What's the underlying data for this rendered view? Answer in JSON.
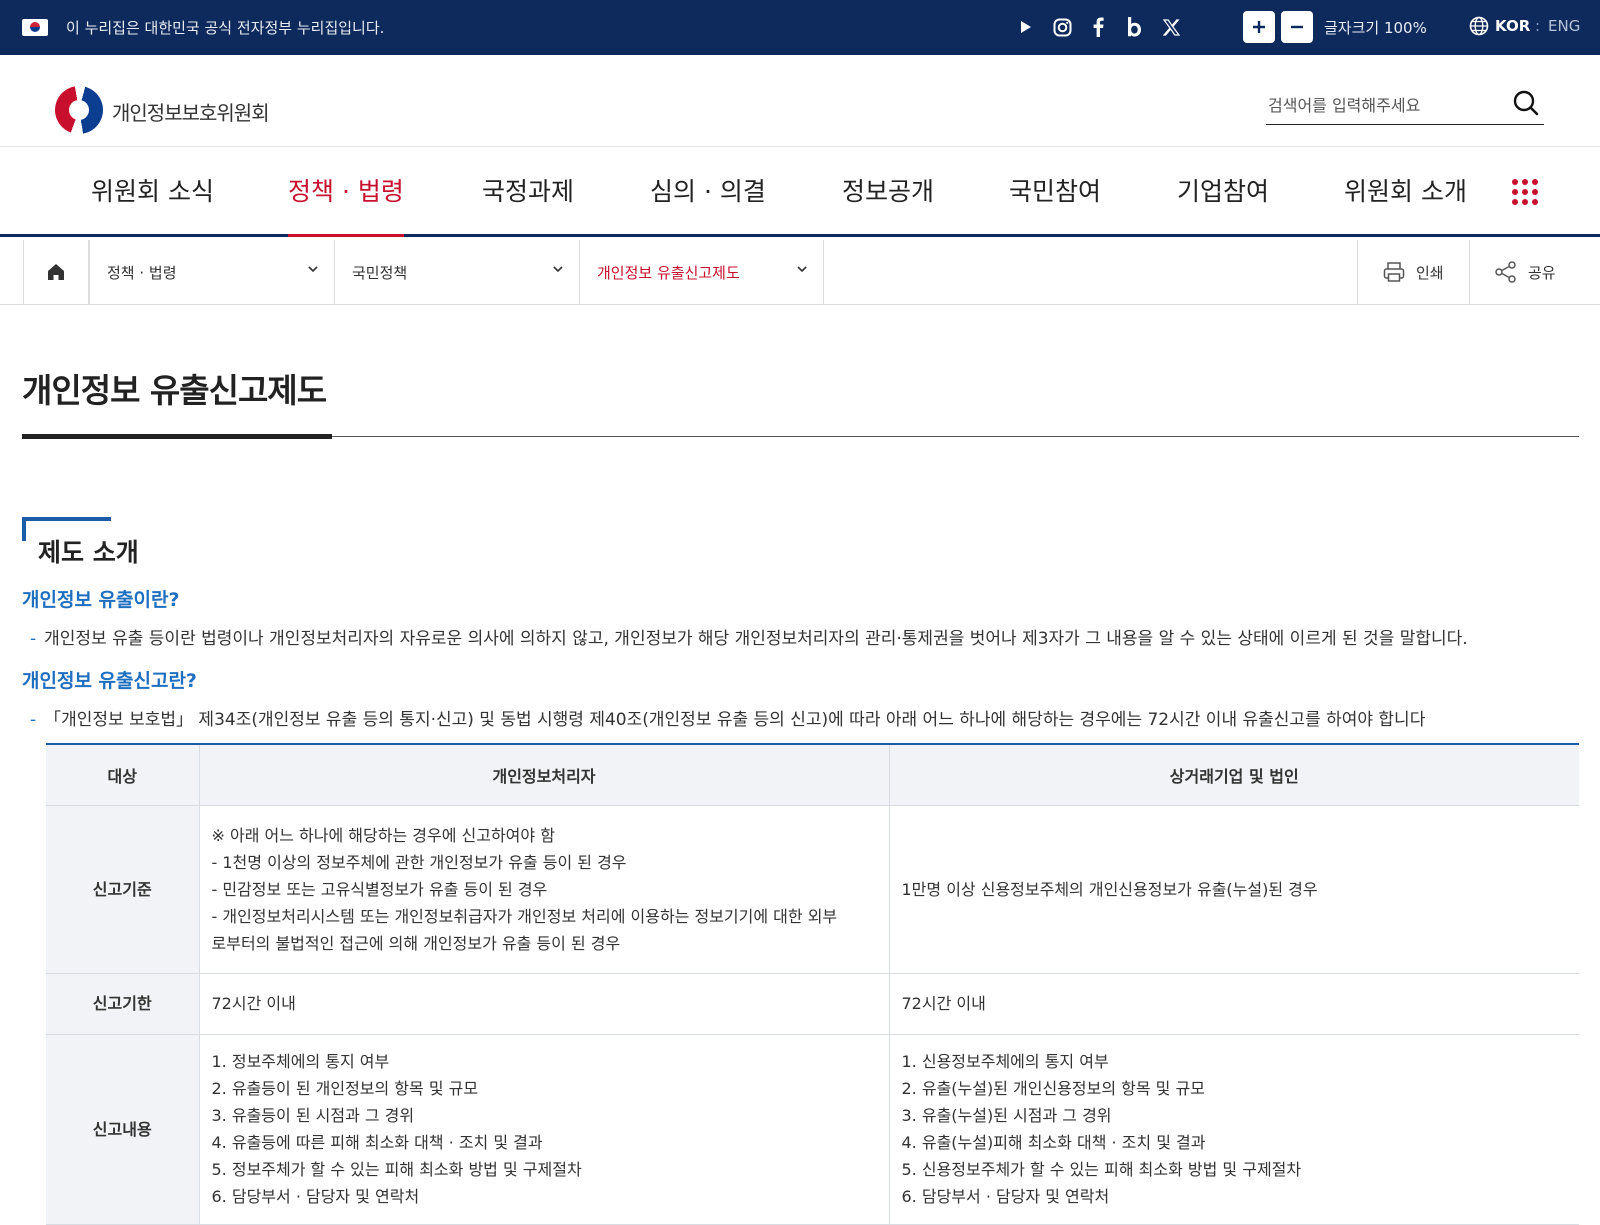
{
  "topbar": {
    "gov_text": "이 누리집은 대한민국 공식 전자정부 누리집입니다.",
    "social_icons": [
      "youtube-icon",
      "instagram-icon",
      "facebook-icon",
      "blog-icon",
      "x-icon"
    ],
    "font_size_label": "글자크기 100%",
    "lang_kor": "KOR",
    "lang_sep": ":",
    "lang_eng": "ENG"
  },
  "header": {
    "logo_text": "개인정보보호위원회",
    "search_placeholder": "검색어를 입력해주세요"
  },
  "gnb": {
    "items": [
      "위원회 소식",
      "정책 · 법령",
      "국정과제",
      "심의 · 의결",
      "정보공개",
      "국민참여",
      "기업참여",
      "위원회 소개"
    ],
    "active_index": 1
  },
  "breadcrumb": {
    "level1": "정책 · 법령",
    "level2": "국민정책",
    "level3": "개인정보 유출신고제도",
    "print_label": "인쇄",
    "share_label": "공유"
  },
  "page": {
    "title": "개인정보 유출신고제도",
    "section_title": "제도 소개",
    "q1": "개인정보 유출이란?",
    "a1": "개인정보 유출 등이란 법령이나 개인정보처리자의 자유로운 의사에 의하지 않고, 개인정보가 해당 개인정보처리자의 관리·통제권을 벗어나 제3자가 그 내용을 알 수 있는 상태에 이르게 된 것을 말합니다.",
    "q2": "개인정보 유출신고란?",
    "a2": "「개인정보 보호법」 제34조(개인정보 유출 등의 통지·신고) 및 동법 시행령 제40조(개인정보 유출 등의 신고)에 따라 아래 어느 하나에 해당하는 경우에는 72시간 이내 유출신고를 하여야 합니다",
    "bullet_dash": "-"
  },
  "table": {
    "headers": [
      "대상",
      "개인정보처리자",
      "상거래기업 및 법인"
    ],
    "rows": [
      {
        "label": "신고기준",
        "col1": [
          "※ 아래 어느 하나에 해당하는 경우에 신고하여야 함",
          "- 1천명 이상의 정보주체에 관한 개인정보가 유출 등이 된 경우",
          "- 민감정보 또는 고유식별정보가 유출 등이 된 경우",
          "- 개인정보처리시스템 또는 개인정보취급자가 개인정보 처리에 이용하는 정보기기에 대한 외부",
          "로부터의 불법적인 접근에 의해 개인정보가 유출 등이 된 경우"
        ],
        "col2": [
          "1만명 이상 신용정보주체의 개인신용정보가 유출(누설)된 경우"
        ]
      },
      {
        "label": "신고기한",
        "col1": [
          "72시간 이내"
        ],
        "col2": [
          "72시간 이내"
        ]
      },
      {
        "label": "신고내용",
        "col1": [
          "1. 정보주체에의 통지 여부",
          "2. 유출등이 된 개인정보의 항목 및 규모",
          "3. 유출등이 된 시점과 그 경위",
          "4. 유출등에 따른 피해 최소화 대책 · 조치 및 결과",
          "5. 정보주체가 할 수 있는 피해 최소화 방법 및 구제절차",
          "6. 담당부서 · 담당자 및 연락처"
        ],
        "col2": [
          "1. 신용정보주체에의 통지 여부",
          "2. 유출(누설)된 개인신용정보의 항목 및 규모",
          "3. 유출(누설)된 시점과 그 경위",
          "4. 유출(누설)피해 최소화 대책 · 조치 및 결과",
          "5. 신용정보주체가 할 수 있는 피해 최소화 방법 및 구제절차",
          "6. 담당부서 · 담당자 및 연락처"
        ]
      }
    ]
  },
  "colors": {
    "topbar_bg": "#0e2a5c",
    "accent_red": "#c8102e",
    "accent_blue": "#1f6fc0"
  }
}
